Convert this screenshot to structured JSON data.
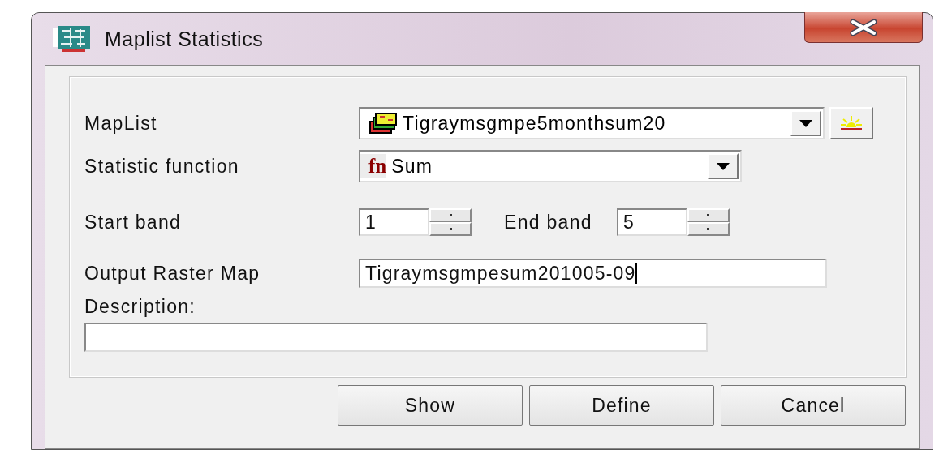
{
  "window": {
    "title": "Maplist Statistics"
  },
  "form": {
    "maplist": {
      "label": "MapList",
      "value": "Tigraymsgmpe5monthsum20"
    },
    "statistic_function": {
      "label": "Statistic function",
      "icon": "fn",
      "value": "Sum"
    },
    "start_band": {
      "label": "Start band",
      "value": "1"
    },
    "end_band": {
      "label": "End band",
      "value": "5"
    },
    "output_map": {
      "label": "Output Raster Map",
      "value": "Tigraymsgmpesum201005-09",
      "focused": true
    },
    "description": {
      "label": "Description:"
    }
  },
  "buttons": [
    {
      "label": "Show"
    },
    {
      "label": "Define"
    },
    {
      "label": "Cancel"
    }
  ]
}
